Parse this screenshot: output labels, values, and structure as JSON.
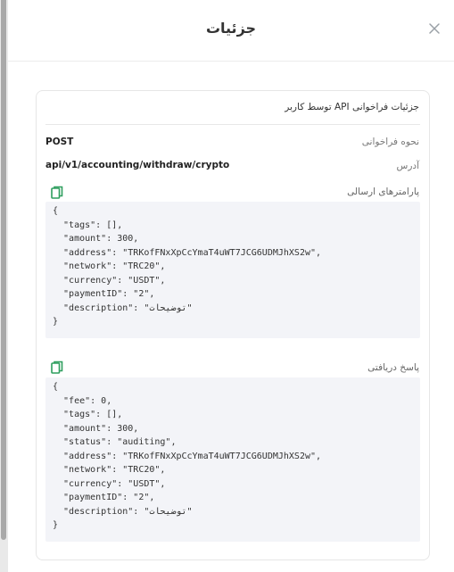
{
  "modal": {
    "title": "جزئیات"
  },
  "card": {
    "title": "جزئیات فراخوانی API توسط کاربر",
    "method_label": "نحوه فراخوانی",
    "method_value": "POST",
    "address_label": "آدرس",
    "address_value": "api/v1/accounting/withdraw/crypto",
    "request_label": "پارامترهای ارسالی",
    "request_body": "{\n  \"tags\": [],\n  \"amount\": 300,\n  \"address\": \"TRKofFNxXpCcYmaT4uWT7JCG6UDMJhXS2w\",\n  \"network\": \"TRC20\",\n  \"currency\": \"USDT\",\n  \"paymentID\": \"2\",\n  \"description\": \"توضیحات\"\n}",
    "response_label": "پاسخ دریافتی",
    "response_body": "{\n  \"fee\": 0,\n  \"tags\": [],\n  \"amount\": 300,\n  \"status\": \"auditing\",\n  \"address\": \"TRKofFNxXpCcYmaT4uWT7JCG6UDMJhXS2w\",\n  \"network\": \"TRC20\",\n  \"currency\": \"USDT\",\n  \"paymentID\": \"2\",\n  \"description\": \"توضیحات\"\n}"
  },
  "icons": {
    "close": "close-icon",
    "copy": "copy-icon"
  },
  "colors": {
    "accent": "#2e9e5e",
    "code_bg": "#f3f4f8"
  }
}
